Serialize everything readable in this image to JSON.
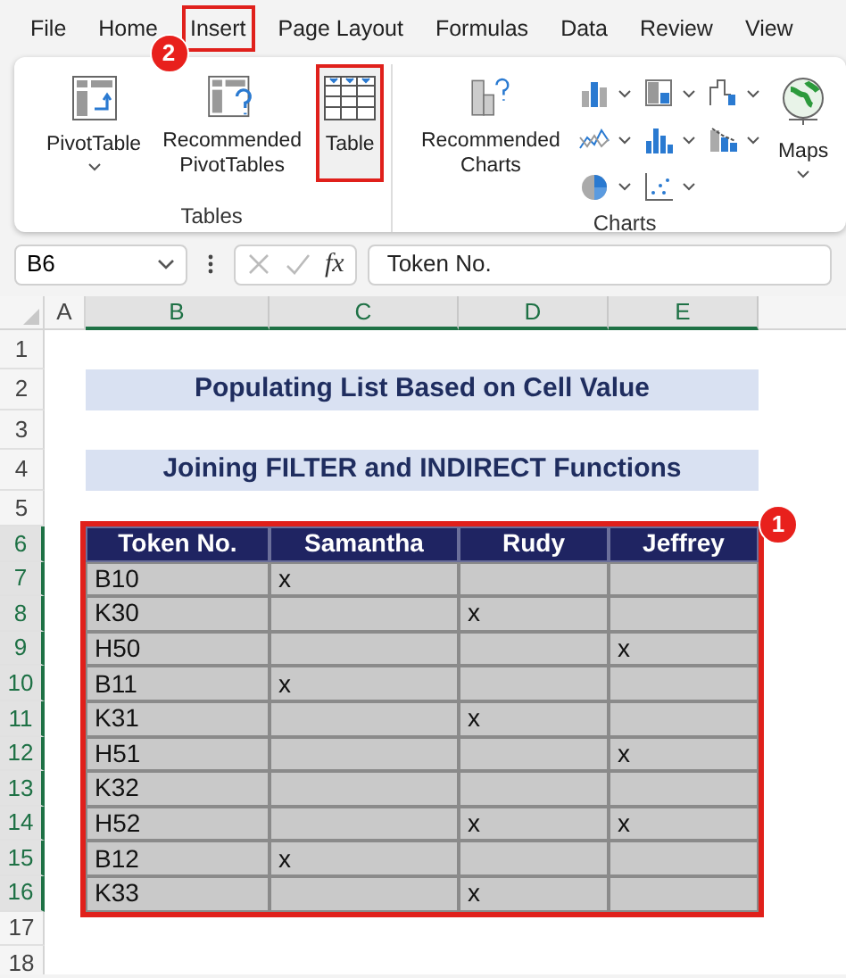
{
  "menu_tabs": [
    {
      "label": "File",
      "highlighted": false
    },
    {
      "label": "Home",
      "highlighted": false
    },
    {
      "label": "Insert",
      "highlighted": true,
      "badge": "2"
    },
    {
      "label": "Page Layout",
      "highlighted": false
    },
    {
      "label": "Formulas",
      "highlighted": false
    },
    {
      "label": "Data",
      "highlighted": false
    },
    {
      "label": "Review",
      "highlighted": false
    },
    {
      "label": "View",
      "highlighted": false
    }
  ],
  "ribbon": {
    "groups": [
      {
        "label": "Tables",
        "buttons": [
          {
            "kind": "pivot-table",
            "label": "PivotTable",
            "dropdown": true,
            "highlighted": false
          },
          {
            "kind": "recommended-pivot",
            "label": "Recommended PivotTables",
            "dropdown": false,
            "highlighted": false
          },
          {
            "kind": "table",
            "label": "Table",
            "dropdown": false,
            "highlighted": true
          }
        ]
      },
      {
        "label": "Charts",
        "buttons": [
          {
            "kind": "recommended-charts",
            "label": "Recommended Charts",
            "dropdown": false,
            "highlighted": false
          },
          {
            "kind": "chart-gallery"
          },
          {
            "kind": "maps",
            "label": "Maps",
            "dropdown": true,
            "highlighted": false
          }
        ]
      }
    ]
  },
  "formula_bar": {
    "name_box": "B6",
    "fx": "fx",
    "formula": "Token No."
  },
  "sheet": {
    "columns": [
      {
        "label": "A",
        "selected": false
      },
      {
        "label": "B",
        "selected": true
      },
      {
        "label": "C",
        "selected": true
      },
      {
        "label": "D",
        "selected": true
      },
      {
        "label": "E",
        "selected": true
      }
    ],
    "rows": [
      {
        "label": "1",
        "selected": false
      },
      {
        "label": "2",
        "selected": false
      },
      {
        "label": "3",
        "selected": false
      },
      {
        "label": "4",
        "selected": false
      },
      {
        "label": "5",
        "selected": false
      },
      {
        "label": "6",
        "selected": true
      },
      {
        "label": "7",
        "selected": true
      },
      {
        "label": "8",
        "selected": true
      },
      {
        "label": "9",
        "selected": true
      },
      {
        "label": "10",
        "selected": true
      },
      {
        "label": "11",
        "selected": true
      },
      {
        "label": "12",
        "selected": true
      },
      {
        "label": "13",
        "selected": true
      },
      {
        "label": "14",
        "selected": true
      },
      {
        "label": "15",
        "selected": true
      },
      {
        "label": "16",
        "selected": true
      },
      {
        "label": "17",
        "selected": false
      },
      {
        "label": "18",
        "selected": false
      }
    ],
    "titles": [
      "Populating List Based on Cell Value",
      "Joining FILTER and INDIRECT Functions"
    ],
    "table": {
      "highlighted": true,
      "badge": "1",
      "columns": [
        "Token No.",
        "Samantha",
        "Rudy",
        "Jeffrey"
      ],
      "rows": [
        [
          "B10",
          "x",
          null,
          null
        ],
        [
          "K30",
          null,
          "x",
          null
        ],
        [
          "H50",
          null,
          null,
          "x"
        ],
        [
          "B11",
          "x",
          null,
          null
        ],
        [
          "K31",
          null,
          "x",
          null
        ],
        [
          "H51",
          null,
          null,
          "x"
        ],
        [
          "K32",
          null,
          null,
          null
        ],
        [
          "H52",
          null,
          "x",
          "x"
        ],
        [
          "B12",
          "x",
          null,
          null
        ],
        [
          "K33",
          null,
          "x",
          null
        ]
      ]
    }
  }
}
